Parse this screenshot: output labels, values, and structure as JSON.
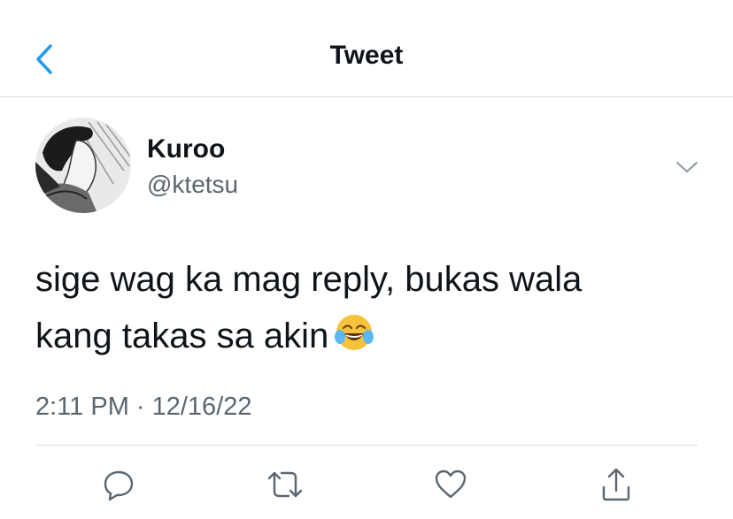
{
  "header": {
    "title": "Tweet",
    "back_icon": "chevron-left-icon"
  },
  "tweet": {
    "author": {
      "display_name": "Kuroo",
      "handle": "@ktetsu"
    },
    "menu_icon": "chevron-down-icon",
    "text_line1": "sige wag ka mag reply, bukas wala",
    "text_line2": "kang takas sa akin",
    "emoji": "face-with-tears-of-joy",
    "timestamp": "2:11 PM · 12/16/22"
  },
  "actions": [
    {
      "icon": "reply-icon"
    },
    {
      "icon": "retweet-icon"
    },
    {
      "icon": "like-icon"
    },
    {
      "icon": "share-icon"
    }
  ],
  "colors": {
    "accent": "#1d9bf0",
    "text": "#0f1419",
    "secondary": "#596670",
    "divider": "#dcdcdc"
  }
}
